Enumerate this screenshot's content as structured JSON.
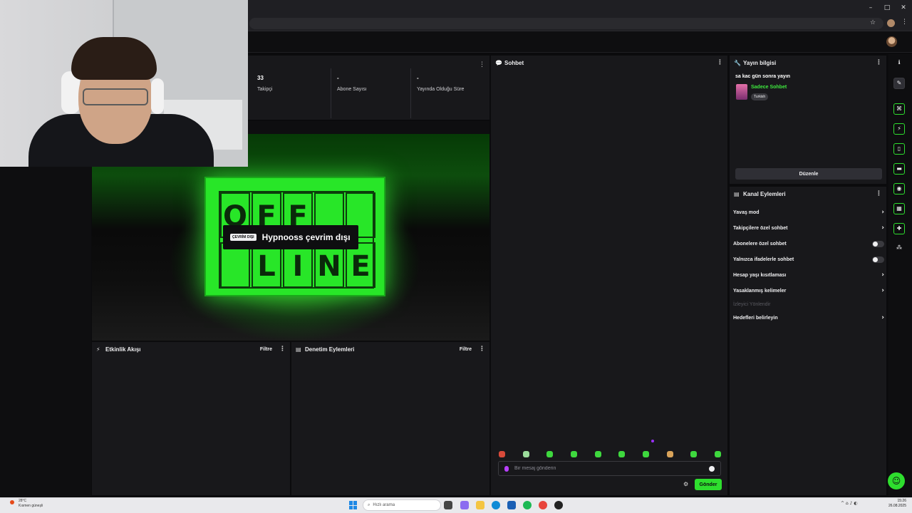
{
  "window": {
    "minimize": "–",
    "maximize": "□",
    "close": "✕"
  },
  "stats": [
    {
      "value": "33",
      "label": "Takipçi"
    },
    {
      "value": "-",
      "label": "Abone Sayısı"
    },
    {
      "value": "-",
      "label": "Yayında Olduğu Süre"
    }
  ],
  "player": {
    "sign_letters": [
      "O",
      "F",
      "F",
      "",
      "",
      "",
      "L",
      "I",
      "N",
      "E"
    ],
    "badge_pill": "ÇEVRİM DIŞI",
    "offline_text": "Hypnooss çevrim dışı"
  },
  "activity_feed": {
    "title": "Etkinlik Akışı",
    "filter": "Filtre"
  },
  "mod_actions": {
    "title": "Denetim Eylemleri",
    "filter": "Filtre"
  },
  "chat": {
    "title": "Sohbet",
    "input_placeholder": "Bir mesaj gönderin",
    "send_label": "Gönder"
  },
  "stream_info": {
    "title": "Yayın bilgisi",
    "stream_title": "sa kac gün sonra yayın",
    "category": "Sadece Sohbet",
    "tag": "Turkish",
    "edit_label": "Düzenle"
  },
  "channel_actions": {
    "title": "Kanal Eylemleri",
    "items": [
      {
        "label": "Yavaş mod",
        "control": "chevron"
      },
      {
        "label": "Takipçilere özel sohbet",
        "control": "chevron"
      },
      {
        "label": "Abonelere özel sohbet",
        "control": "toggle"
      },
      {
        "label": "Yalnızca ifadelerle sohbet",
        "control": "toggle"
      },
      {
        "label": "Hesap yaşı kısıtlaması",
        "control": "chevron"
      },
      {
        "label": "Yasaklanmış kelimeler",
        "control": "chevron"
      },
      {
        "label": "İzleyici Yönlendir",
        "control": "none"
      },
      {
        "label": "Hedefleri belirleyin",
        "control": "chevron"
      }
    ]
  },
  "taskbar": {
    "weather_temp": "28°C",
    "weather_desc": "Kısmen güneşli",
    "search_placeholder": "Hızlı arama",
    "time": "15:26",
    "date": "26.08.2025"
  },
  "colors": {
    "accent": "#2ede2e",
    "panel": "#18181b",
    "background": "#0b0b0d"
  }
}
